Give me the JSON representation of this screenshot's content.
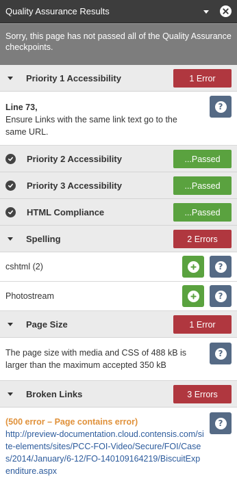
{
  "header": {
    "title": "Quality Assurance Results"
  },
  "alert": {
    "message": "Sorry, this page has not passed all of the Quality Assurance checkpoints."
  },
  "sections": [
    {
      "label": "Priority 1 Accessibility",
      "status": "1 Error",
      "items": [
        {
          "title": "Line 73,",
          "text": "Ensure Links with the same link text go to the same URL."
        }
      ]
    },
    {
      "label": "Priority 2 Accessibility",
      "status": "...Passed"
    },
    {
      "label": "Priority 3 Accessibility",
      "status": "...Passed"
    },
    {
      "label": "HTML Compliance",
      "status": "...Passed"
    },
    {
      "label": "Spelling",
      "status": "2 Errors",
      "items": [
        {
          "text": "cshtml (2)"
        },
        {
          "text": "Photostream"
        }
      ]
    },
    {
      "label": "Page Size",
      "status": "1 Error",
      "items": [
        {
          "text": "The page size with media and CSS of 488 kB is larger than the maximum accepted 350 kB"
        }
      ]
    },
    {
      "label": "Broken Links",
      "status": "3 Errors",
      "items": [
        {
          "error": "(500 error – Page contains error)",
          "url": "http://preview-documentation.cloud.contensis.com/site-elements/sites/PCC-FOI-Video/Secure/FOI/Cases/2014/January/6-12/FO-140109164219/BiscuitExpenditure.aspx"
        }
      ]
    }
  ],
  "help_icon_glyph": "?",
  "colors": {
    "titlebar": "#3d3d3d",
    "alert": "#7d7d7d",
    "error": "#b0373f",
    "passed": "#5aa23f",
    "help": "#556a85",
    "warning_text": "#e0913a",
    "link": "#2c5b9c"
  }
}
